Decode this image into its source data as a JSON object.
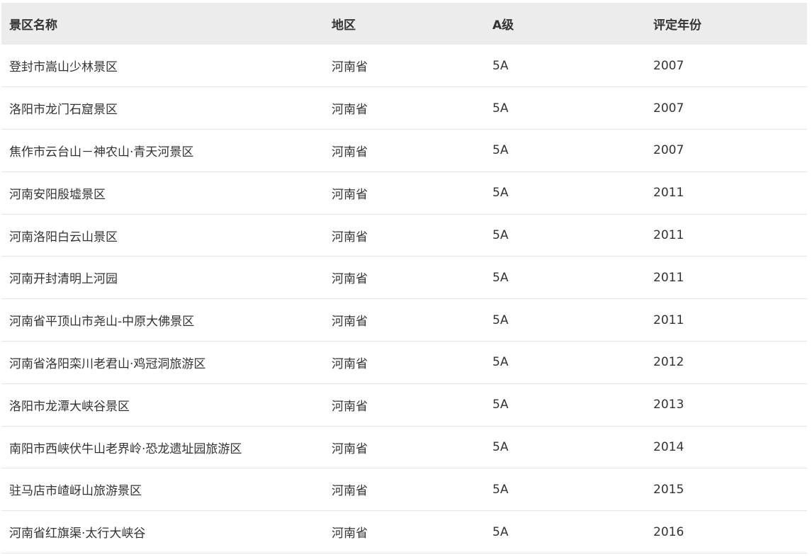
{
  "table": {
    "columns": [
      "景区名称",
      "地区",
      "A级",
      "评定年份"
    ],
    "rows": [
      [
        "登封市嵩山少林景区",
        "河南省",
        "5A",
        "2007"
      ],
      [
        "洛阳市龙门石窟景区",
        "河南省",
        "5A",
        "2007"
      ],
      [
        "焦作市云台山－神农山·青天河景区",
        "河南省",
        "5A",
        "2007"
      ],
      [
        "河南安阳殷墟景区",
        "河南省",
        "5A",
        "2011"
      ],
      [
        "河南洛阳白云山景区",
        "河南省",
        "5A",
        "2011"
      ],
      [
        "河南开封清明上河园",
        "河南省",
        "5A",
        "2011"
      ],
      [
        "河南省平顶山市尧山-中原大佛景区",
        "河南省",
        "5A",
        "2011"
      ],
      [
        "河南省洛阳栾川老君山·鸡冠洞旅游区",
        "河南省",
        "5A",
        "2012"
      ],
      [
        "洛阳市龙潭大峡谷景区",
        "河南省",
        "5A",
        "2013"
      ],
      [
        "南阳市西峡伏牛山老界岭·恐龙遗址园旅游区",
        "河南省",
        "5A",
        "2014"
      ],
      [
        "驻马店市嵖岈山旅游景区",
        "河南省",
        "5A",
        "2015"
      ],
      [
        "河南省红旗渠·太行大峡谷",
        "河南省",
        "5A",
        "2016"
      ]
    ]
  },
  "colors": {
    "header_bg": "#ececec",
    "row_divider": "#e6e6e6",
    "text": "#333333"
  }
}
